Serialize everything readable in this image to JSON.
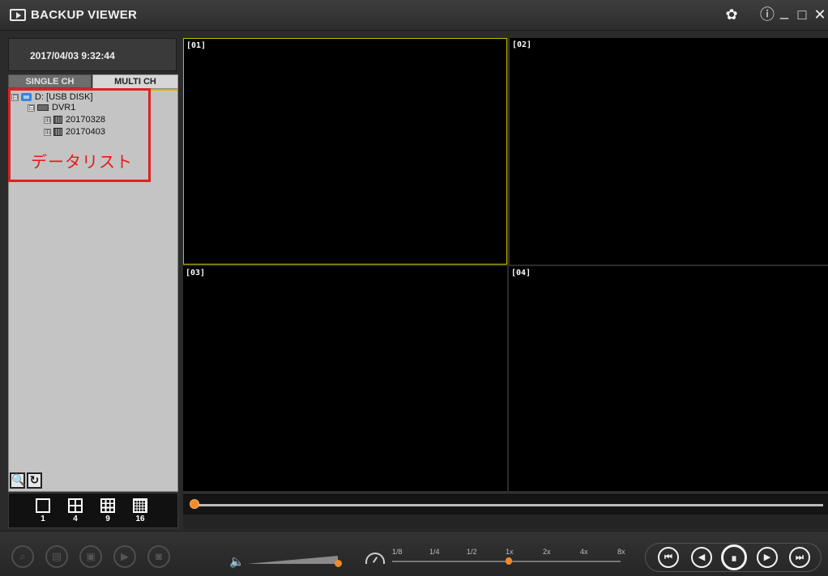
{
  "titlebar": {
    "title": "BACKUP VIEWER",
    "icons": [
      "play-window-icon",
      "gear-icon",
      "info-icon",
      "minimize-icon",
      "maximize-icon",
      "close-icon"
    ],
    "gear_glyph": "✿",
    "info_glyph": "ⓘ",
    "min_glyph": "_",
    "max_glyph": "□",
    "close_glyph": "✕"
  },
  "left": {
    "datetime": "2017/04/03 9:32:44",
    "tabs": [
      {
        "label": "SINGLE CH",
        "active": false
      },
      {
        "label": "MULTI CH",
        "active": true
      }
    ],
    "tree": {
      "root": "D: [USB DISK]",
      "dvr": "DVR1",
      "dates": [
        "20170328",
        "20170403"
      ],
      "expander": "⊟",
      "collapsed": "⊞"
    },
    "annotation": "データリスト",
    "search_glyph": "🔍",
    "refresh_glyph": "↻"
  },
  "layouts": [
    {
      "label": "1",
      "grid": 1
    },
    {
      "label": "4",
      "grid": 2
    },
    {
      "label": "9",
      "grid": 3
    },
    {
      "label": "16",
      "grid": 4
    }
  ],
  "channels": [
    "[01]",
    "[02]",
    "[03]",
    "[04]"
  ],
  "controls": {
    "volume_glyph": "🔈",
    "speed_labels": [
      "1/8",
      "1/4",
      "1/2",
      "1x",
      "2x",
      "4x",
      "8x"
    ],
    "speed_selected": "1x",
    "playback_glyphs": [
      "⏮",
      "◀",
      "⏸",
      "▶",
      "⏭"
    ]
  },
  "colors": {
    "accent": "#f08a2a",
    "selected_border": "#c8b800",
    "annotation_red": "#e02020"
  }
}
